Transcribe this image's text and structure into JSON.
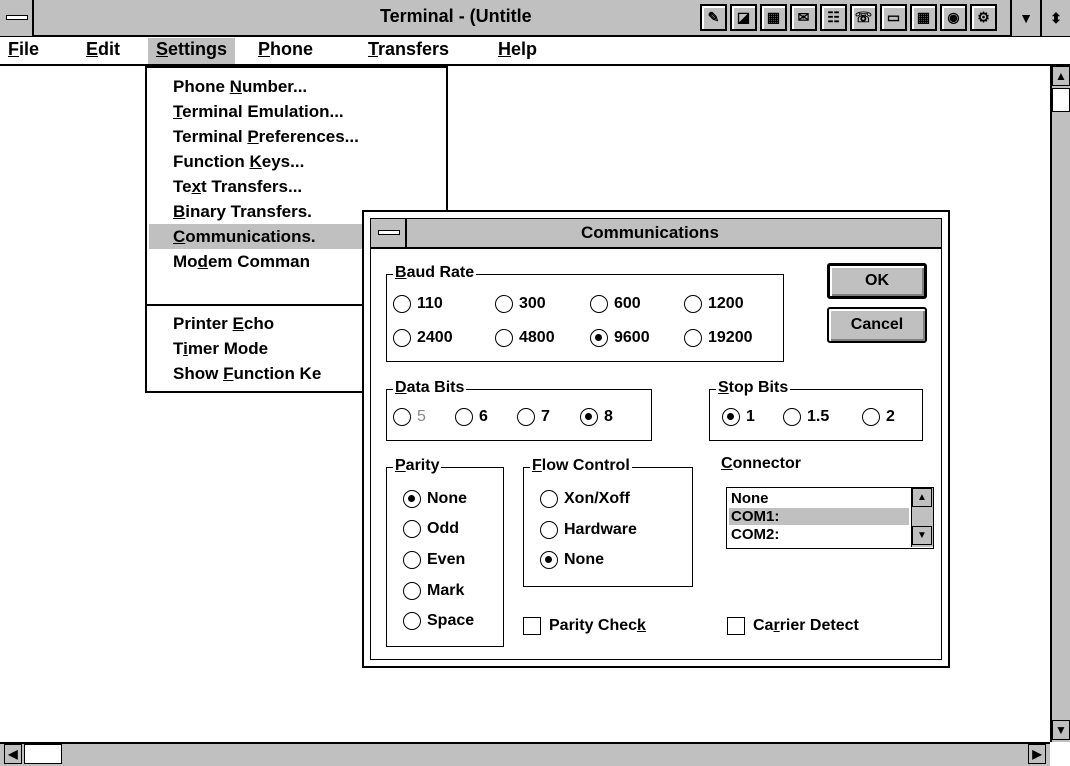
{
  "window": {
    "title": "Terminal - (Untitle"
  },
  "menubar": {
    "items": [
      {
        "pre": "",
        "key": "F",
        "post": "ile"
      },
      {
        "pre": "",
        "key": "E",
        "post": "dit"
      },
      {
        "pre": "",
        "key": "S",
        "post": "ettings"
      },
      {
        "pre": "",
        "key": "P",
        "post": "hone"
      },
      {
        "pre": "",
        "key": "T",
        "post": "ransfers"
      },
      {
        "pre": "",
        "key": "H",
        "post": "elp"
      }
    ]
  },
  "settings_menu": {
    "items": [
      {
        "pre": "Phone ",
        "key": "N",
        "post": "umber..."
      },
      {
        "pre": "",
        "key": "T",
        "post": "erminal Emulation..."
      },
      {
        "pre": "Terminal ",
        "key": "P",
        "post": "references..."
      },
      {
        "pre": "Function ",
        "key": "K",
        "post": "eys..."
      },
      {
        "pre": "Te",
        "key": "x",
        "post": "t Transfers..."
      },
      {
        "pre": "",
        "key": "B",
        "post": "inary Transfers."
      },
      {
        "pre": "",
        "key": "C",
        "post": "ommunications."
      },
      {
        "pre": "Mo",
        "key": "d",
        "post": "em Comman"
      },
      {
        "pre": "Printer ",
        "key": "E",
        "post": "cho"
      },
      {
        "pre": "T",
        "key": "i",
        "post": "mer Mode"
      },
      {
        "pre": "Show ",
        "key": "F",
        "post": "unction Ke"
      }
    ],
    "selected_index": 6
  },
  "dialog": {
    "title": "Communications",
    "ok_label": "OK",
    "cancel_label": "Cancel",
    "baud": {
      "label_key": "B",
      "label_post": "aud Rate",
      "options": [
        "110",
        "300",
        "600",
        "1200",
        "2400",
        "4800",
        "9600",
        "19200"
      ],
      "selected": "9600"
    },
    "data_bits": {
      "label_key": "D",
      "label_post": "ata Bits",
      "options": [
        "5",
        "6",
        "7",
        "8"
      ],
      "selected": "8",
      "disabled": "5"
    },
    "stop_bits": {
      "label_key": "S",
      "label_post": "top Bits",
      "options": [
        "1",
        "1.5",
        "2"
      ],
      "selected": "1"
    },
    "parity": {
      "label_key": "P",
      "label_post": "arity",
      "options": [
        "None",
        "Odd",
        "Even",
        "Mark",
        "Space"
      ],
      "selected": "None"
    },
    "flow_control": {
      "label_key": "F",
      "label_post": "low Control",
      "options": [
        "Xon/Xoff",
        "Hardware",
        "None"
      ],
      "selected": "None"
    },
    "connector": {
      "label_key": "C",
      "label_post": "onnector",
      "items": [
        "None",
        "COM1:",
        "COM2:"
      ],
      "selected": "COM1:"
    },
    "parity_check": {
      "pre": "Parity Chec",
      "key": "k",
      "post": ""
    },
    "carrier_detect": {
      "pre": "Ca",
      "key": "r",
      "post": "rier Detect"
    }
  },
  "icons": [
    "system-menu-icon",
    "toolbar-icons",
    "minimize-icon",
    "restore-icon",
    "scroll-up-icon",
    "scroll-down-icon",
    "scroll-left-icon",
    "scroll-right-icon"
  ],
  "colors": {
    "chrome": "#c0c0c0",
    "highlight": "#c0c0c0",
    "text": "#000000"
  }
}
